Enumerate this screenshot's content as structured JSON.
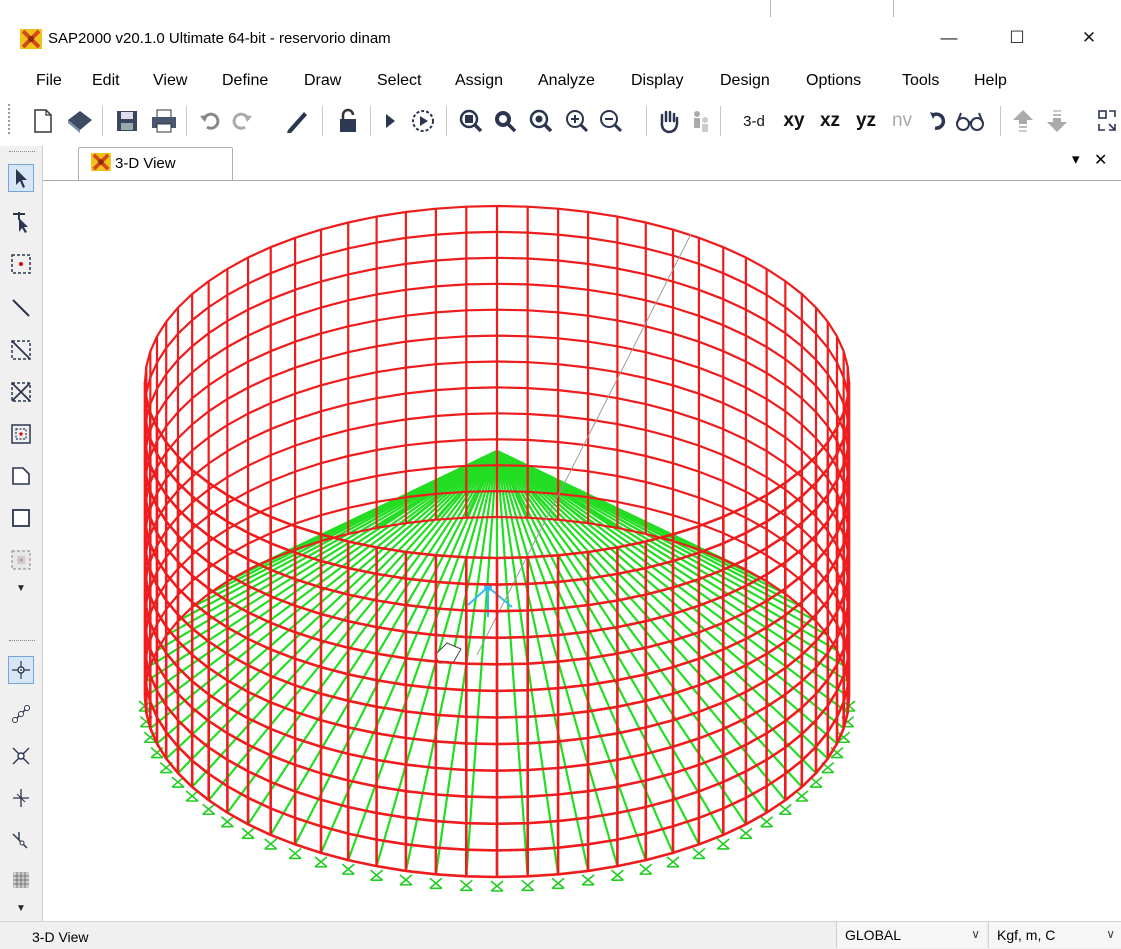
{
  "window": {
    "title": "SAP2000 v20.1.0 Ultimate 64-bit - reservorio dinam",
    "minimize": "—",
    "maximize": "☐",
    "close": "✕"
  },
  "menu": [
    "File",
    "Edit",
    "View",
    "Define",
    "Draw",
    "Select",
    "Assign",
    "Analyze",
    "Display",
    "Design",
    "Options",
    "Tools",
    "Help"
  ],
  "toolbar": {
    "view_3d": "3-d",
    "view_xy": "xy",
    "view_xz": "xz",
    "view_yz": "yz",
    "view_nv": "nv"
  },
  "tab": {
    "label": "3-D View",
    "dropdown": "▾",
    "close": "✕"
  },
  "status": {
    "text": "3-D View",
    "coord_system": "GLOBAL",
    "units": "Kgf, m, C"
  },
  "colors": {
    "frame_wall": "#ee1c1c",
    "frame_radial": "#22dd22",
    "restraint": "#22cc22",
    "axes": "#33bbee",
    "accent": "#d14a1c"
  }
}
